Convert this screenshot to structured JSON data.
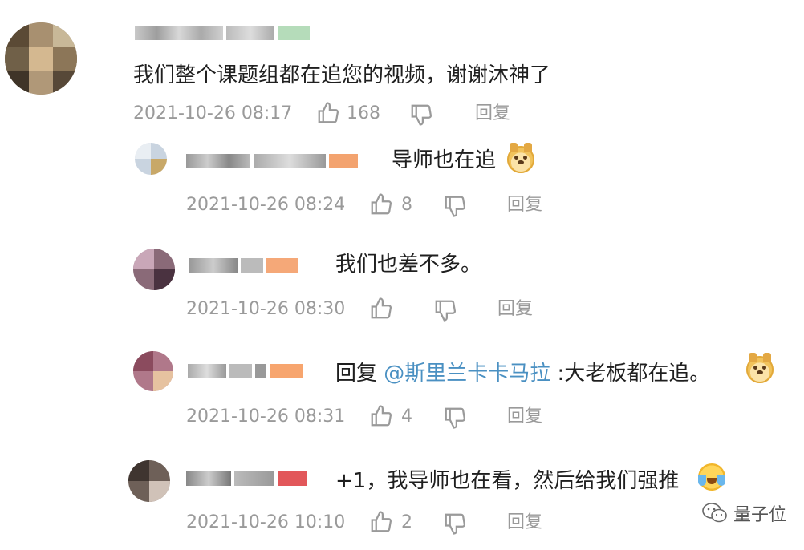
{
  "comment": {
    "text": "我们整个课题组都在追您的视频，谢谢沐神了",
    "time": "2021-10-26 08:17",
    "likes": "168",
    "reply_label": "回复",
    "accent_name_color": "#a8d8b0"
  },
  "replies": [
    {
      "text": "导师也在追",
      "time": "2021-10-26 08:24",
      "likes": "8",
      "reply_label": "回复",
      "emoji": "doge-icon"
    },
    {
      "text": "我们也差不多。",
      "time": "2021-10-26 08:30",
      "likes": "",
      "reply_label": "回复"
    },
    {
      "prefix": "回复 ",
      "mention": "@斯里兰卡卡马拉",
      "text": " :大老板都在追。",
      "time": "2021-10-26 08:31",
      "likes": "4",
      "reply_label": "回复",
      "emoji": "doge-icon"
    },
    {
      "text": "+1，我导师也在看，然后给我们强推",
      "time": "2021-10-26 10:10",
      "likes": "2",
      "reply_label": "回复",
      "emoji": "crying-laugh-icon"
    }
  ],
  "watermark": {
    "label": "量子位",
    "icon": "wechat-icon"
  },
  "colors": {
    "meta": "#9a9a9a",
    "mention": "#4a90c2",
    "text": "#1f1f1f"
  }
}
